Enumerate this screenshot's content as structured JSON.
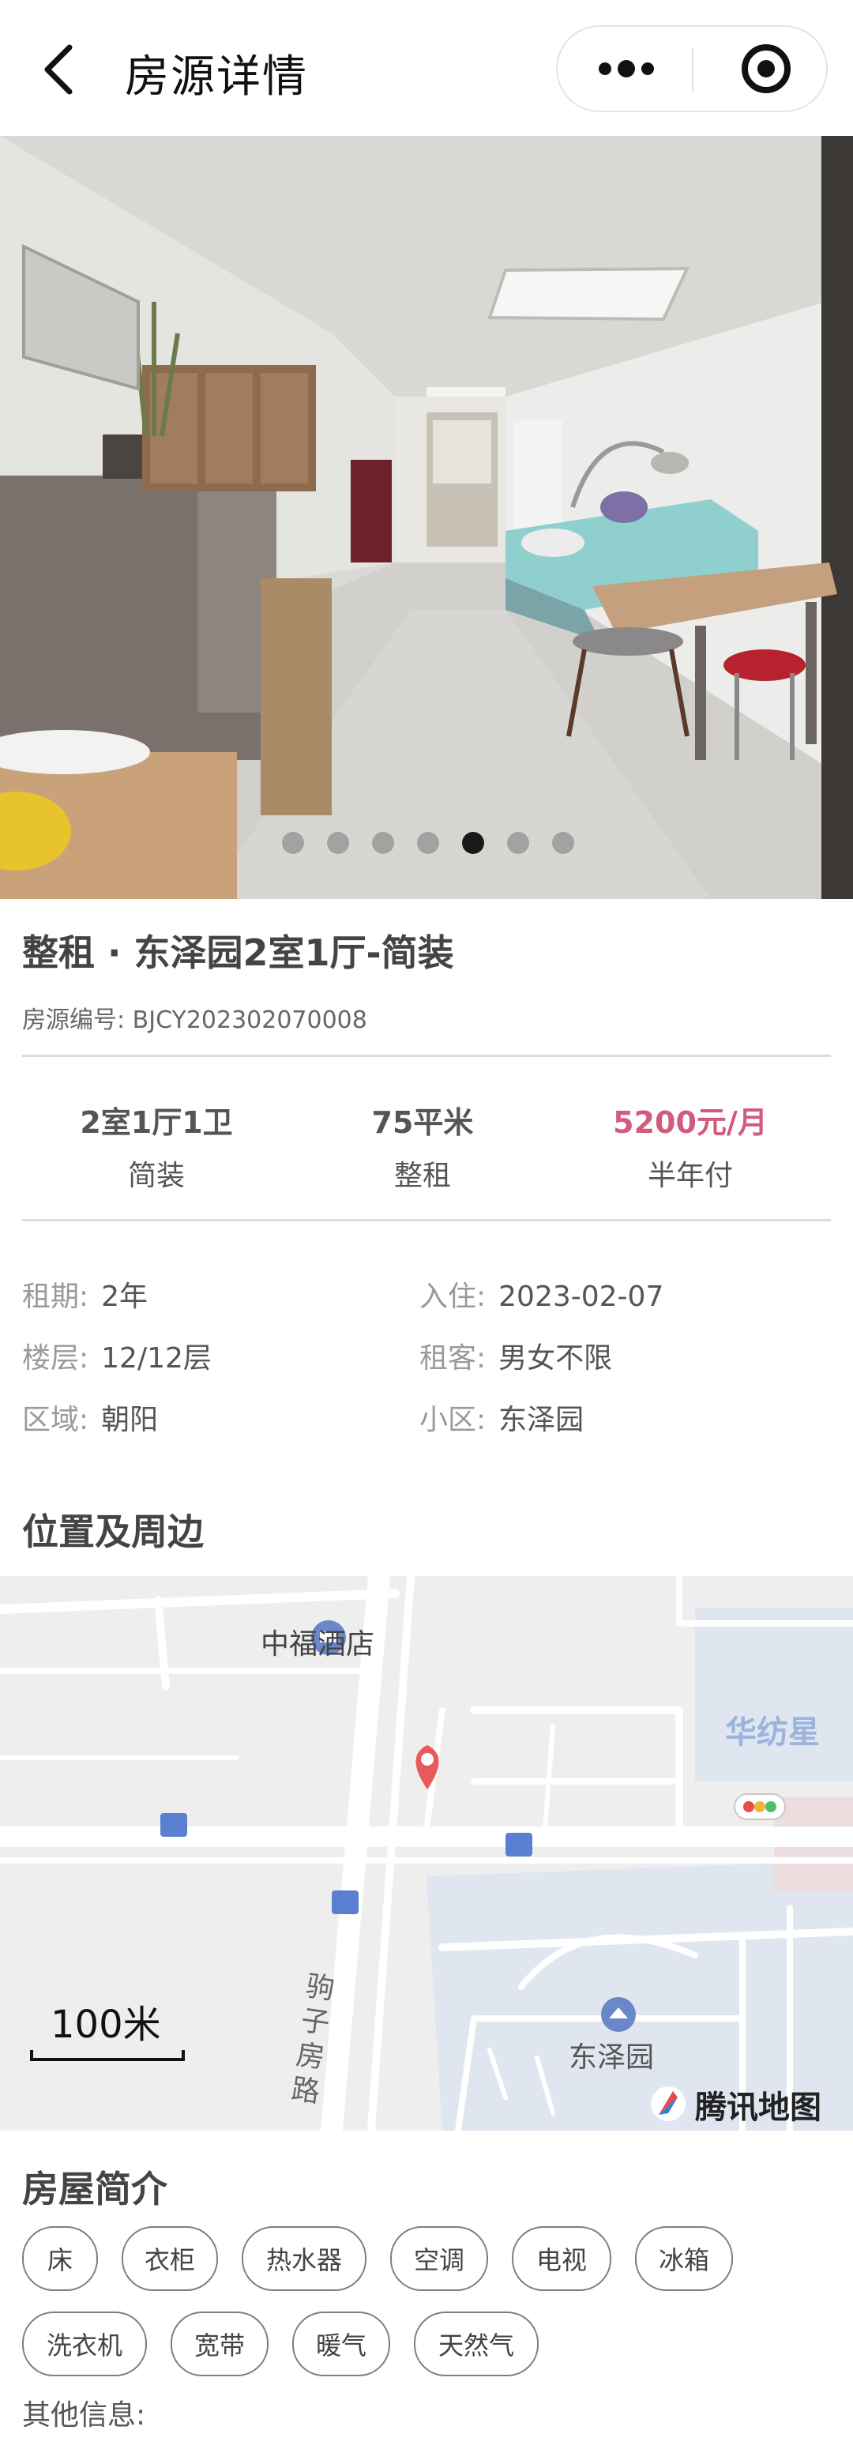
{
  "nav": {
    "title": "房源详情"
  },
  "gallery": {
    "image_count": 7,
    "active_index": 4
  },
  "listing": {
    "title": "整租 · 东泽园2室1厅-简装",
    "code": "房源编号: BJCY202302070008"
  },
  "stats": [
    {
      "value": "2室1厅1卫",
      "sub": "简装"
    },
    {
      "value": "75平米",
      "sub": "整租"
    },
    {
      "value": "5200元/月",
      "sub": "半年付"
    }
  ],
  "info": [
    {
      "key": "租期:",
      "value": "2年"
    },
    {
      "key": "入住:",
      "value": "2023-02-07"
    },
    {
      "key": "楼层:",
      "value": "12/12层"
    },
    {
      "key": "租客:",
      "value": "男女不限"
    },
    {
      "key": "区域:",
      "value": "朝阳"
    },
    {
      "key": "小区:",
      "value": "东泽园"
    }
  ],
  "location": {
    "heading": "位置及周边",
    "labels": {
      "hotel": "中福酒店",
      "building": "华纺星",
      "community": "东泽园",
      "road": "驹子房路",
      "scale": "100米",
      "brand": "腾讯地图"
    }
  },
  "intro": {
    "heading": "房屋简介",
    "amenities": [
      "床",
      "衣柜",
      "热水器",
      "空调",
      "电视",
      "冰箱",
      "洗衣机",
      "宽带",
      "暖气",
      "天然气"
    ],
    "other_label": "其他信息:"
  },
  "colors": {
    "price": "#d05b7c",
    "map_pin": "#e85a5a",
    "map_block": "#dfe6f0"
  }
}
